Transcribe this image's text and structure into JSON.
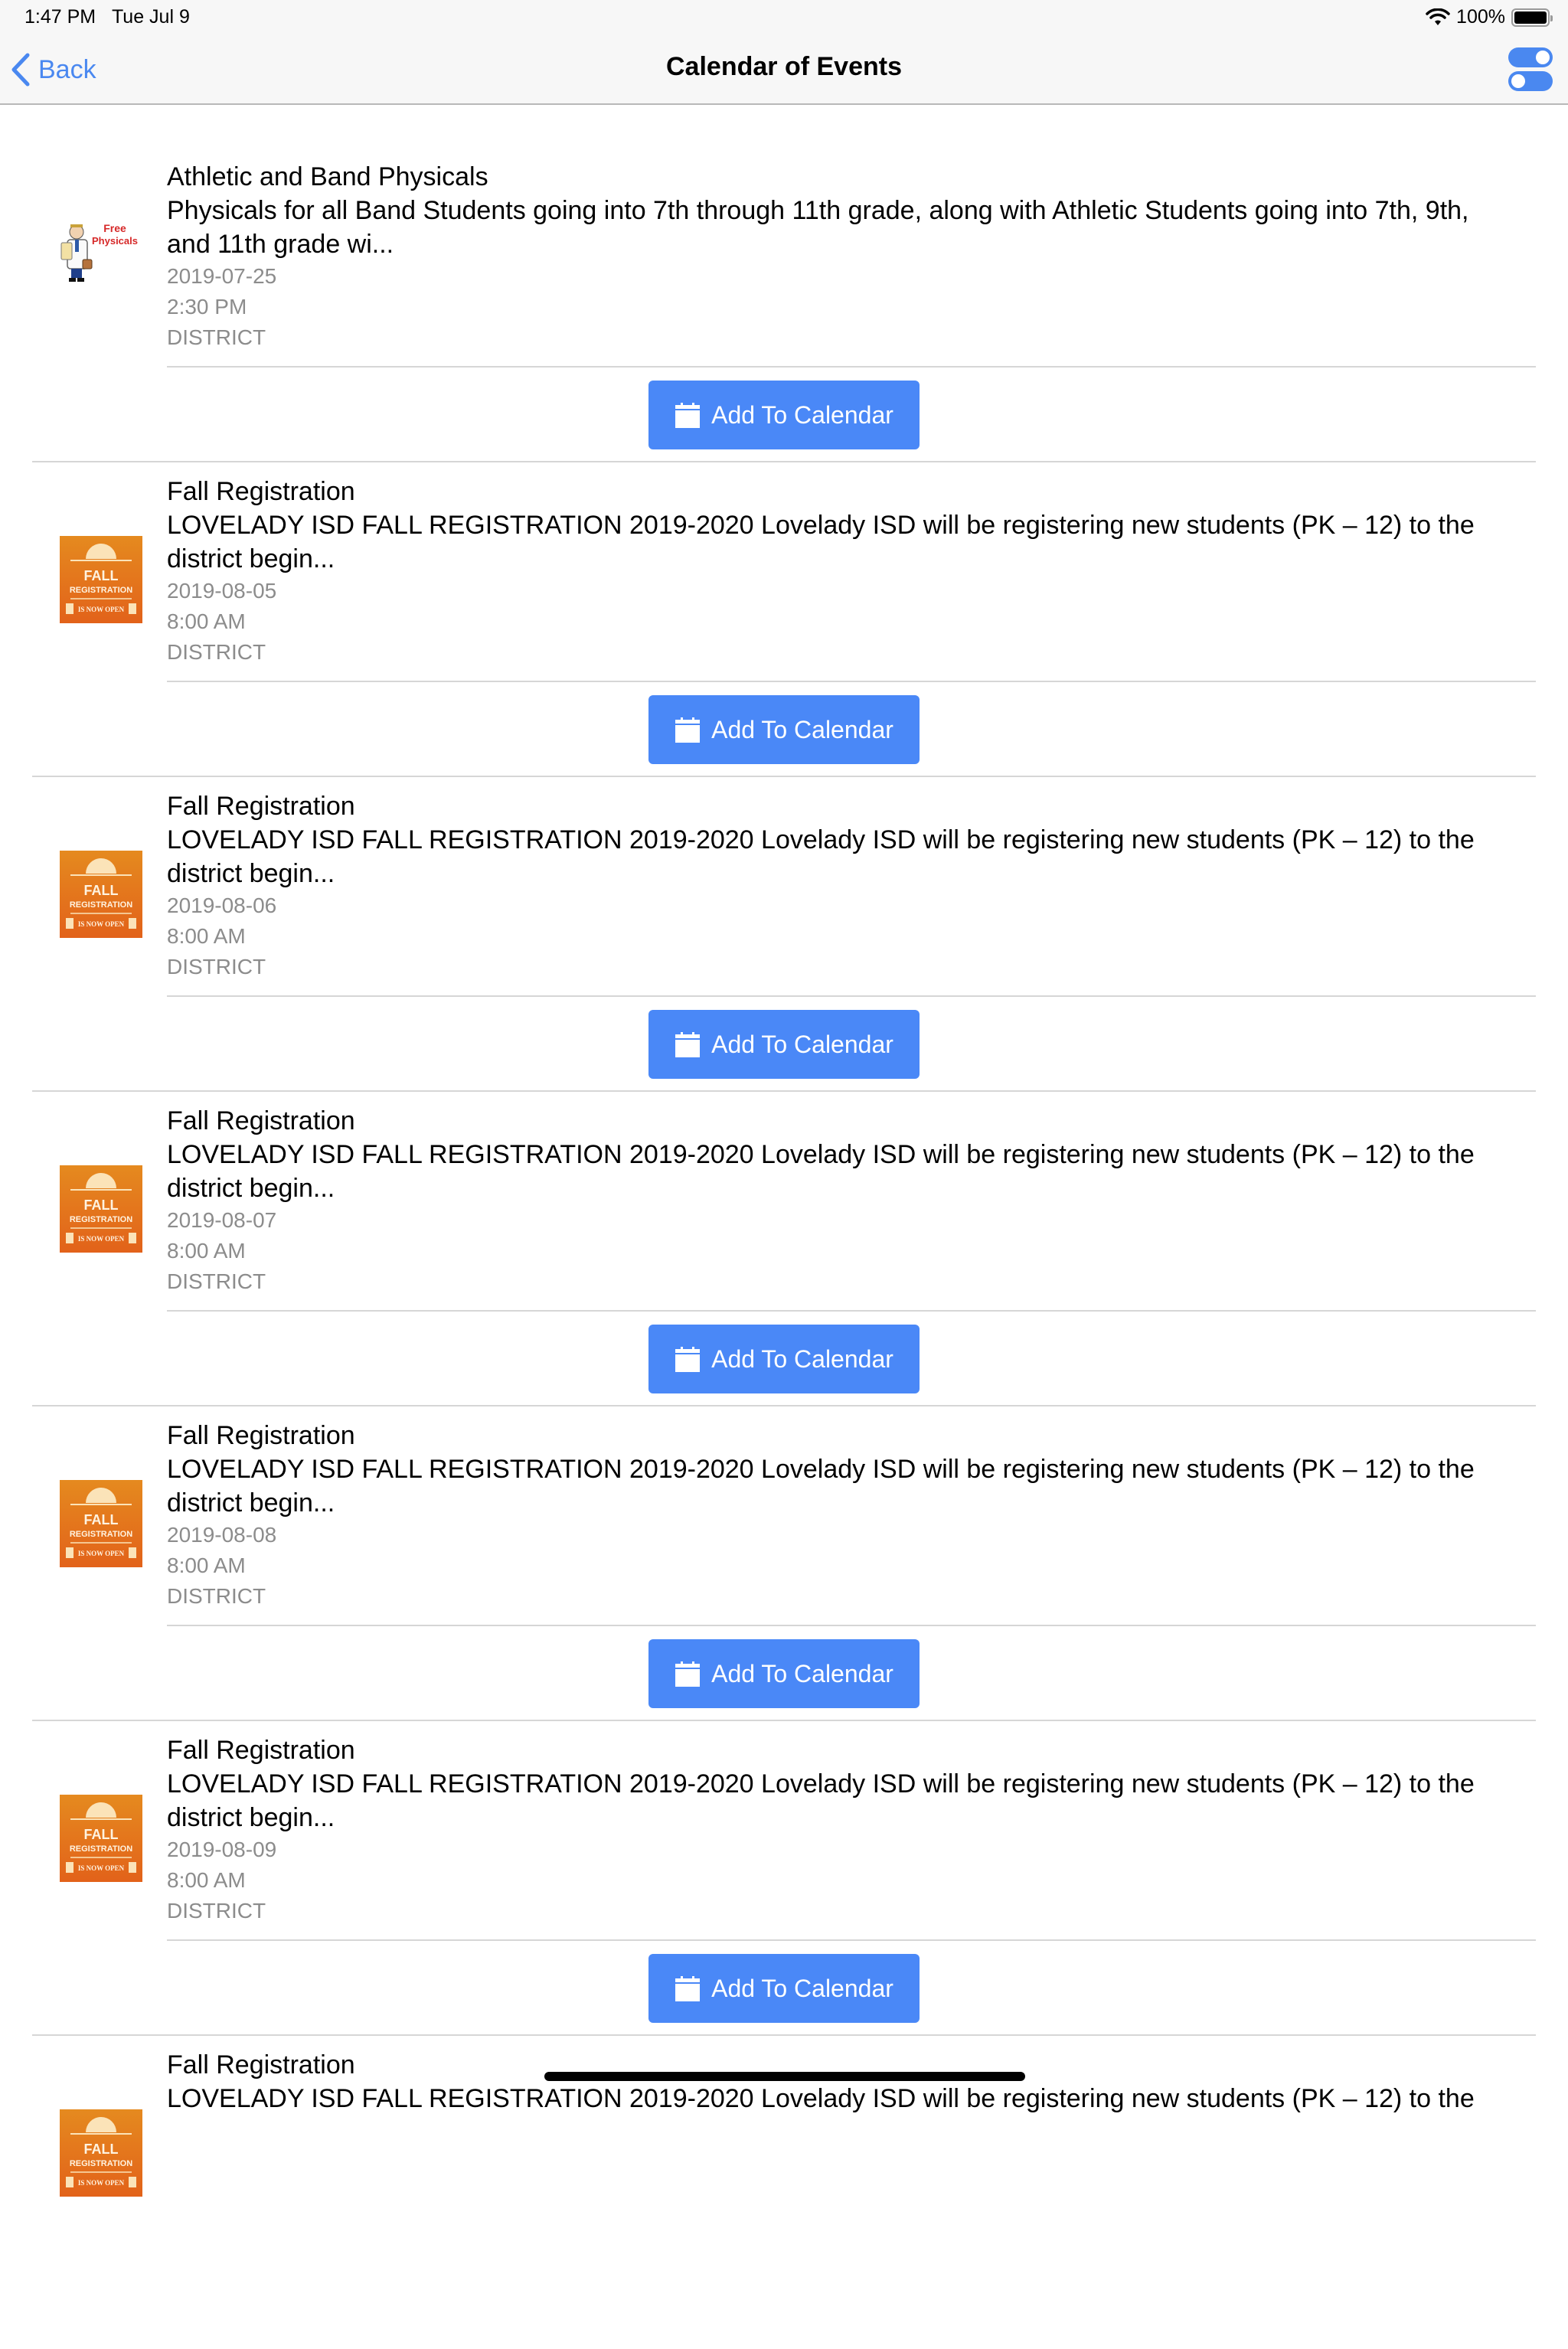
{
  "status_bar": {
    "time": "1:47 PM",
    "date": "Tue Jul 9",
    "battery": "100%"
  },
  "nav": {
    "back_label": "Back",
    "title": "Calendar of Events",
    "accent_color": "#4a88f0"
  },
  "events": [
    {
      "thumbnail": "free-physicals-image",
      "thumb_text": [
        "Free",
        "Physicals"
      ],
      "title": "Athletic and Band Physicals",
      "description": "Physicals for all Band Students going into 7th through 11th grade, along with Athletic Students going into 7th, 9th, and 11th grade wi...",
      "date": "2019-07-25",
      "time": "2:30 PM",
      "category": "DISTRICT",
      "button_label": "Add To Calendar"
    },
    {
      "thumbnail": "fall-registration-image",
      "thumb_text": [
        "FALL",
        "REGISTRATION",
        "IS NOW OPEN"
      ],
      "title": "Fall Registration",
      "description": "LOVELADY ISD FALL REGISTRATION 2019-2020   Lovelady ISD will be registering new students (PK – 12) to the district begin...",
      "date": "2019-08-05",
      "time": "8:00 AM",
      "category": "DISTRICT",
      "button_label": "Add To Calendar"
    },
    {
      "thumbnail": "fall-registration-image",
      "thumb_text": [
        "FALL",
        "REGISTRATION",
        "IS NOW OPEN"
      ],
      "title": "Fall Registration",
      "description": "LOVELADY ISD FALL REGISTRATION 2019-2020   Lovelady ISD will be registering new students (PK – 12) to the district begin...",
      "date": "2019-08-06",
      "time": "8:00 AM",
      "category": "DISTRICT",
      "button_label": "Add To Calendar"
    },
    {
      "thumbnail": "fall-registration-image",
      "thumb_text": [
        "FALL",
        "REGISTRATION",
        "IS NOW OPEN"
      ],
      "title": "Fall Registration",
      "description": "LOVELADY ISD FALL REGISTRATION 2019-2020   Lovelady ISD will be registering new students (PK – 12) to the district begin...",
      "date": "2019-08-07",
      "time": "8:00 AM",
      "category": "DISTRICT",
      "button_label": "Add To Calendar"
    },
    {
      "thumbnail": "fall-registration-image",
      "thumb_text": [
        "FALL",
        "REGISTRATION",
        "IS NOW OPEN"
      ],
      "title": "Fall Registration",
      "description": "LOVELADY ISD FALL REGISTRATION 2019-2020   Lovelady ISD will be registering new students (PK – 12) to the district begin...",
      "date": "2019-08-08",
      "time": "8:00 AM",
      "category": "DISTRICT",
      "button_label": "Add To Calendar"
    },
    {
      "thumbnail": "fall-registration-image",
      "thumb_text": [
        "FALL",
        "REGISTRATION",
        "IS NOW OPEN"
      ],
      "title": "Fall Registration",
      "description": "LOVELADY ISD FALL REGISTRATION 2019-2020   Lovelady ISD will be registering new students (PK – 12) to the district begin...",
      "date": "2019-08-09",
      "time": "8:00 AM",
      "category": "DISTRICT",
      "button_label": "Add To Calendar"
    },
    {
      "thumbnail": "fall-registration-image",
      "thumb_text": [
        "FALL",
        "REGISTRATION",
        "IS NOW OPEN"
      ],
      "title": "Fall Registration",
      "description": "LOVELADY ISD FALL REGISTRATION 2019-2020   Lovelady ISD will be registering new students (PK – 12) to the",
      "date": "",
      "time": "",
      "category": "",
      "button_label": ""
    }
  ]
}
